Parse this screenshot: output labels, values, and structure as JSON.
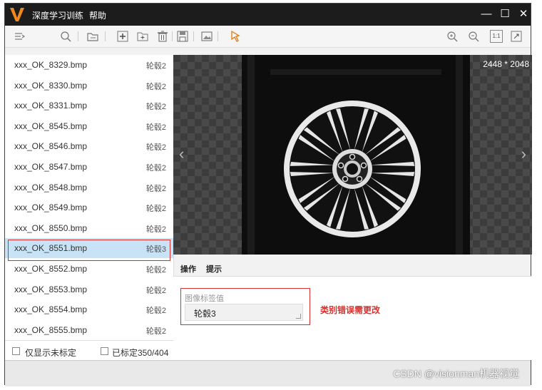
{
  "window": {
    "title": "深度学习训练",
    "menu_help": "帮助",
    "minimize": "—",
    "maximize": "☐",
    "close": "✕"
  },
  "toolbar": {
    "icons": [
      "list-filter-icon",
      "search-icon",
      "folder-import-icon",
      "add-icon",
      "add-folder-icon",
      "delete-icon",
      "save-icon",
      "image-export-icon",
      "pointer-icon",
      "zoom-in-icon",
      "zoom-out-icon",
      "actual-size-icon",
      "fit-window-icon"
    ],
    "actual_size_label": "1:1"
  },
  "file_list": [
    {
      "name": "xxx_OK_8329.bmp",
      "label": "轮毂2"
    },
    {
      "name": "xxx_OK_8330.bmp",
      "label": "轮毂2"
    },
    {
      "name": "xxx_OK_8331.bmp",
      "label": "轮毂2"
    },
    {
      "name": "xxx_OK_8545.bmp",
      "label": "轮毂2"
    },
    {
      "name": "xxx_OK_8546.bmp",
      "label": "轮毂2"
    },
    {
      "name": "xxx_OK_8547.bmp",
      "label": "轮毂2"
    },
    {
      "name": "xxx_OK_8548.bmp",
      "label": "轮毂2"
    },
    {
      "name": "xxx_OK_8549.bmp",
      "label": "轮毂2"
    },
    {
      "name": "xxx_OK_8550.bmp",
      "label": "轮毂2"
    },
    {
      "name": "xxx_OK_8551.bmp",
      "label": "轮毂3",
      "selected": true
    },
    {
      "name": "xxx_OK_8552.bmp",
      "label": "轮毂2"
    },
    {
      "name": "xxx_OK_8553.bmp",
      "label": "轮毂2"
    },
    {
      "name": "xxx_OK_8554.bmp",
      "label": "轮毂2"
    },
    {
      "name": "xxx_OK_8555.bmp",
      "label": "轮毂2"
    }
  ],
  "filters": {
    "show_unlabeled": "仅显示未标定",
    "labeled_count": "已标定350/404"
  },
  "viewer": {
    "dimensions": "2448 * 2048",
    "prev": "‹",
    "next": "›"
  },
  "tabs": {
    "operate": "操作",
    "hint": "提示"
  },
  "label_field": {
    "label": "图像标签值",
    "value": "轮毂3"
  },
  "annotation": {
    "text": "类别错误需更改",
    "color": "#d9302c"
  },
  "watermark": "CSDN @visionman机器视觉"
}
